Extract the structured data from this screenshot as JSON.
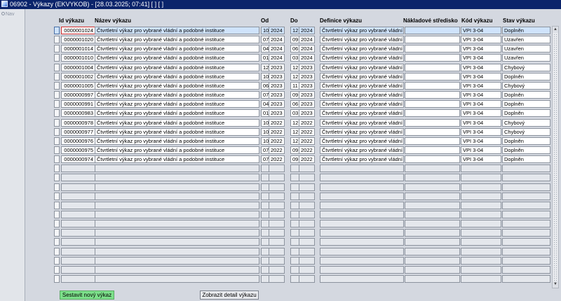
{
  "window": {
    "title": "06902 - Výkazy (EKVYKOB) - [28.03.2025; 07:41]  [ ]  [ ]"
  },
  "nav": {
    "label": "Nav"
  },
  "table": {
    "headers": {
      "id": "Id výkazu",
      "nazev": "Název výkazu",
      "od": "Od",
      "do": "Do",
      "definice": "Definice výkazu",
      "stredisko": "Nákladové středisko",
      "kod": "Kód výkazu",
      "stav": "Stav výkazu"
    },
    "rows": [
      {
        "id": "0000001024",
        "nazev": "Čtvrtletní výkaz pro vybrané vládní a podobné instituce",
        "od_m": "10",
        "od_y": "2024",
        "do_m": "12",
        "do_y": "2024",
        "definice": "Čtvrtletní výkaz pro vybrané vládní a",
        "stredisko": "",
        "kod": "VPI 3-04",
        "stav": "Doplněn"
      },
      {
        "id": "0000001020",
        "nazev": "Čtvrtletní výkaz pro vybrané vládní a podobné instituce",
        "od_m": "07",
        "od_y": "2024",
        "do_m": "09",
        "do_y": "2024",
        "definice": "Čtvrtletní výkaz pro vybrané vládní a",
        "stredisko": "",
        "kod": "VPI 3-04",
        "stav": "Uzavřen"
      },
      {
        "id": "0000001014",
        "nazev": "Čtvrtletní výkaz pro vybrané vládní a podobné instituce",
        "od_m": "04",
        "od_y": "2024",
        "do_m": "06",
        "do_y": "2024",
        "definice": "Čtvrtletní výkaz pro vybrané vládní a",
        "stredisko": "",
        "kod": "VPI 3-04",
        "stav": "Uzavřen"
      },
      {
        "id": "0000001010",
        "nazev": "Čtvrtletní výkaz pro vybrané vládní a podobné instituce",
        "od_m": "01",
        "od_y": "2024",
        "do_m": "03",
        "do_y": "2024",
        "definice": "Čtvrtletní výkaz pro vybrané vládní a",
        "stredisko": "",
        "kod": "VPI 3-04",
        "stav": "Uzavřen"
      },
      {
        "id": "0000001004",
        "nazev": "Čtvrtletní výkaz pro vybrané vládní a podobné instituce",
        "od_m": "12",
        "od_y": "2023",
        "do_m": "12",
        "do_y": "2023",
        "definice": "Čtvrtletní výkaz pro vybrané vládní a",
        "stredisko": "",
        "kod": "VPI 3-04",
        "stav": "Chybový"
      },
      {
        "id": "0000001002",
        "nazev": "Čtvrtletní výkaz pro vybrané vládní a podobné instituce",
        "od_m": "10",
        "od_y": "2023",
        "do_m": "12",
        "do_y": "2023",
        "definice": "Čtvrtletní výkaz pro vybrané vládní a",
        "stredisko": "",
        "kod": "VPI 3-04",
        "stav": "Doplněn"
      },
      {
        "id": "0000001005",
        "nazev": "Čtvrtletní výkaz pro vybrané vládní a podobné instituce",
        "od_m": "06",
        "od_y": "2023",
        "do_m": "11",
        "do_y": "2023",
        "definice": "Čtvrtletní výkaz pro vybrané vládní a",
        "stredisko": "",
        "kod": "VPI 3-04",
        "stav": "Chybový"
      },
      {
        "id": "0000000997",
        "nazev": "Čtvrtletní výkaz pro vybrané vládní a podobné instituce",
        "od_m": "07",
        "od_y": "2023",
        "do_m": "09",
        "do_y": "2023",
        "definice": "Čtvrtletní výkaz pro vybrané vládní a",
        "stredisko": "",
        "kod": "VPI 3-04",
        "stav": "Doplněn"
      },
      {
        "id": "0000000991",
        "nazev": "Čtvrtletní výkaz pro vybrané vládní a podobné instituce",
        "od_m": "04",
        "od_y": "2023",
        "do_m": "06",
        "do_y": "2023",
        "definice": "Čtvrtletní výkaz pro vybrané vládní a",
        "stredisko": "",
        "kod": "VPI 3-04",
        "stav": "Doplněn"
      },
      {
        "id": "0000000983",
        "nazev": "Čtvrtletní výkaz pro vybrané vládní a podobné instituce",
        "od_m": "01",
        "od_y": "2023",
        "do_m": "03",
        "do_y": "2023",
        "definice": "Čtvrtletní výkaz pro vybrané vládní a",
        "stredisko": "",
        "kod": "VPI 3-04",
        "stav": "Doplněn"
      },
      {
        "id": "0000000978",
        "nazev": "Čtvrtletní výkaz pro vybrané vládní a podobné instituce",
        "od_m": "10",
        "od_y": "2022",
        "do_m": "12",
        "do_y": "2022",
        "definice": "Čtvrtletní výkaz pro vybrané vládní a",
        "stredisko": "",
        "kod": "VPI 3-04",
        "stav": "Chybový"
      },
      {
        "id": "0000000977",
        "nazev": "Čtvrtletní výkaz pro vybrané vládní a podobné instituce",
        "od_m": "10",
        "od_y": "2022",
        "do_m": "12",
        "do_y": "2022",
        "definice": "Čtvrtletní výkaz pro vybrané vládní a",
        "stredisko": "",
        "kod": "VPI 3-04",
        "stav": "Chybový"
      },
      {
        "id": "0000000976",
        "nazev": "Čtvrtletní výkaz pro vybrané vládní a podobné instituce",
        "od_m": "10",
        "od_y": "2022",
        "do_m": "12",
        "do_y": "2022",
        "definice": "Čtvrtletní výkaz pro vybrané vládní a",
        "stredisko": "",
        "kod": "VPI 3-04",
        "stav": "Doplněn"
      },
      {
        "id": "0000000975",
        "nazev": "Čtvrtletní výkaz pro vybrané vládní a podobné instituce",
        "od_m": "07",
        "od_y": "2022",
        "do_m": "09",
        "do_y": "2022",
        "definice": "Čtvrtletní výkaz pro vybrané vládní a",
        "stredisko": "",
        "kod": "VPI 3-04",
        "stav": "Doplněn"
      },
      {
        "id": "0000000974",
        "nazev": "Čtvrtletní výkaz pro vybrané vládní a podobné instituce",
        "od_m": "07",
        "od_y": "2022",
        "do_m": "09",
        "do_y": "2022",
        "definice": "Čtvrtletní výkaz pro vybrané vládní a",
        "stredisko": "",
        "kod": "VPI 3-04",
        "stav": "Doplněn"
      }
    ],
    "empty_row_count": 13,
    "selected_row": 0
  },
  "buttons": {
    "new_report": "Sestavit nový výkaz",
    "show_detail": "Zobrazit detail výkazu"
  },
  "colors": {
    "titlebar": "#0b246b",
    "primary_button": "#7ce08a",
    "selected_row": "#cfe3fb",
    "focus_border": "#d43030"
  }
}
